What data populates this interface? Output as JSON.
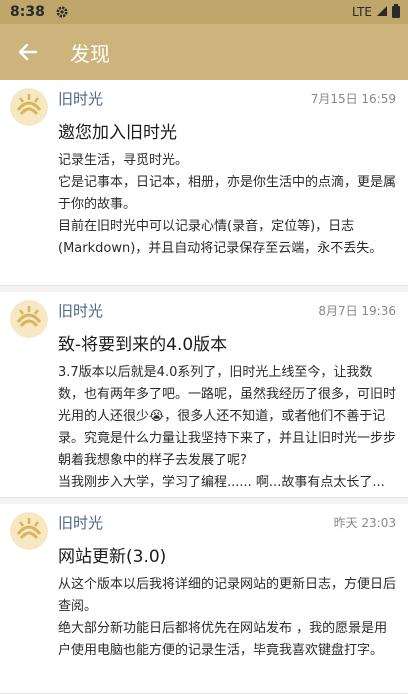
{
  "status_bar": {
    "time": "8:38",
    "network": "LTE",
    "icons": [
      "gear-icon",
      "signal-icon",
      "battery-icon"
    ]
  },
  "app_bar": {
    "title": "发现",
    "back_icon": "arrow-left-icon"
  },
  "colors": {
    "status_bar": "#bfa66a",
    "app_bar": "#cdb47c",
    "author": "#4d6788",
    "background": "#f3f3f3"
  },
  "posts": [
    {
      "author": "旧时光",
      "date": "7月15日  16:59",
      "title": "邀您加入旧时光",
      "body": "记录生活，寻觅时光。\n它是记事本，日记本，相册，亦是你生活中的点滴，更是属于你的故事。\n目前在旧时光中可以记录心情(录音，定位等)，日志(Markdown)，并且自动将记录保存至云端，永不丢失。"
    },
    {
      "author": "旧时光",
      "date": "8月7日  19:36",
      "title": "致-将要到来的4.0版本",
      "body": "3.7版本以后就是4.0系列了，旧时光上线至今，让我数数，也有两年多了吧。一路呢，虽然我经历了很多，可旧时光用的人还很少😭，很多人还不知道，或者他们不善于记录。究竟是什么力量让我坚持下来了，并且让旧时光一步步朝着我想象中的样子去发展了呢?\n当我刚步入大学，学习了编程...... 啊...故事有点太长了..."
    },
    {
      "author": "旧时光",
      "date": "昨天 23:03",
      "title": "网站更新(3.0)",
      "body": "从这个版本以后我将详细的记录网站的更新日志，方便日后查阅。\n绝大部分新功能日后都将优先在网站发布 ，我的愿景是用户使用电脑也能方便的记录生活，毕竟我喜欢键盘打字。"
    }
  ]
}
